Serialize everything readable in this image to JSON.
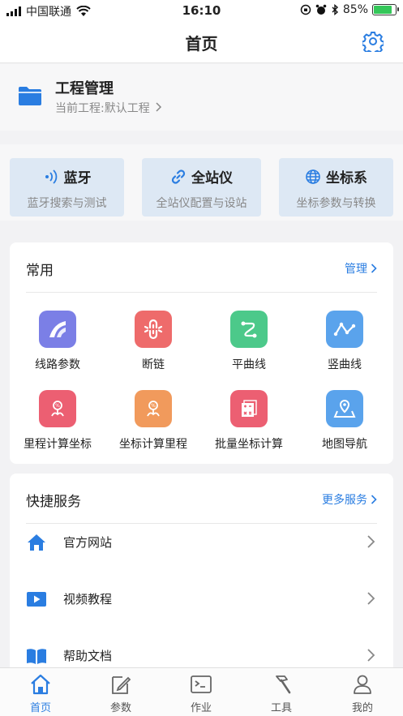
{
  "status": {
    "carrier": "中国联通",
    "time": "16:10",
    "battery": "85%",
    "battery_level": 0.85
  },
  "nav": {
    "title": "首页",
    "settings_icon": "gear-icon"
  },
  "project": {
    "title": "工程管理",
    "subtitle": "当前工程:默认工程",
    "icon": "folder-icon"
  },
  "quick": [
    {
      "title": "蓝牙",
      "subtitle": "蓝牙搜索与测试",
      "icon": "bluetooth-icon"
    },
    {
      "title": "全站仪",
      "subtitle": "全站仪配置与设站",
      "icon": "link-icon"
    },
    {
      "title": "坐标系",
      "subtitle": "坐标参数与转换",
      "icon": "globe-icon"
    }
  ],
  "common": {
    "title": "常用",
    "more": "管理",
    "items": [
      {
        "label": "线路参数",
        "color": "#7b7fe6",
        "icon": "route-curve-icon"
      },
      {
        "label": "断链",
        "color": "#ee6b6b",
        "icon": "broken-chain-icon"
      },
      {
        "label": "平曲线",
        "color": "#4cc98a",
        "icon": "plane-curve-icon"
      },
      {
        "label": "竖曲线",
        "color": "#5aa3ec",
        "icon": "vertical-curve-icon"
      },
      {
        "label": "里程计算坐标",
        "color": "#ec5f72",
        "icon": "mileage-to-coordinate-icon"
      },
      {
        "label": "坐标计算里程",
        "color": "#f19a5c",
        "icon": "coordinate-to-mileage-icon"
      },
      {
        "label": "批量坐标计算",
        "color": "#ec5f72",
        "icon": "batch-calculate-icon"
      },
      {
        "label": "地图导航",
        "color": "#5aa3ec",
        "icon": "map-navigation-icon"
      }
    ]
  },
  "services": {
    "title": "快捷服务",
    "more": "更多服务",
    "items": [
      {
        "label": "官方网站",
        "icon": "home-icon"
      },
      {
        "label": "视频教程",
        "icon": "video-play-icon"
      },
      {
        "label": "帮助文档",
        "icon": "book-icon"
      }
    ]
  },
  "tabs": [
    {
      "label": "首页",
      "icon": "home-icon",
      "active": true
    },
    {
      "label": "参数",
      "icon": "edit-icon",
      "active": false
    },
    {
      "label": "作业",
      "icon": "terminal-icon",
      "active": false
    },
    {
      "label": "工具",
      "icon": "hammer-icon",
      "active": false
    },
    {
      "label": "我的",
      "icon": "user-icon",
      "active": false
    }
  ],
  "colors": {
    "accent": "#2a7de1",
    "tile_bg": "#dde8f4"
  }
}
